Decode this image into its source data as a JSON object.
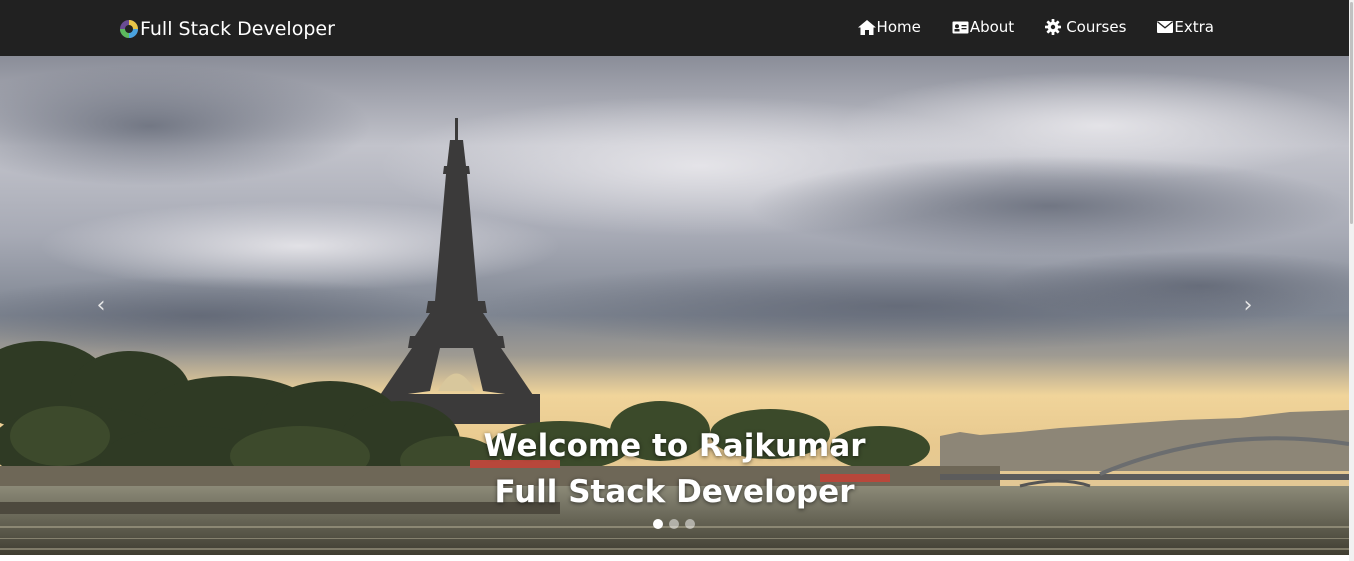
{
  "navbar": {
    "brand": "Full Stack Developer",
    "links": [
      {
        "label": "Home",
        "icon": "home-icon"
      },
      {
        "label": "About",
        "icon": "id-card-icon"
      },
      {
        "label": "Courses",
        "icon": "gear-icon"
      },
      {
        "label": "Extra",
        "icon": "envelope-icon"
      }
    ]
  },
  "carousel": {
    "caption_line1": "Welcome to Rajkumar",
    "caption_line2": "Full Stack Developer",
    "prev_arrow": "‹",
    "next_arrow": "›",
    "slide_count": 3,
    "active_slide": 1
  },
  "colors": {
    "navbar_bg": "#212121",
    "text": "#ffffff"
  }
}
